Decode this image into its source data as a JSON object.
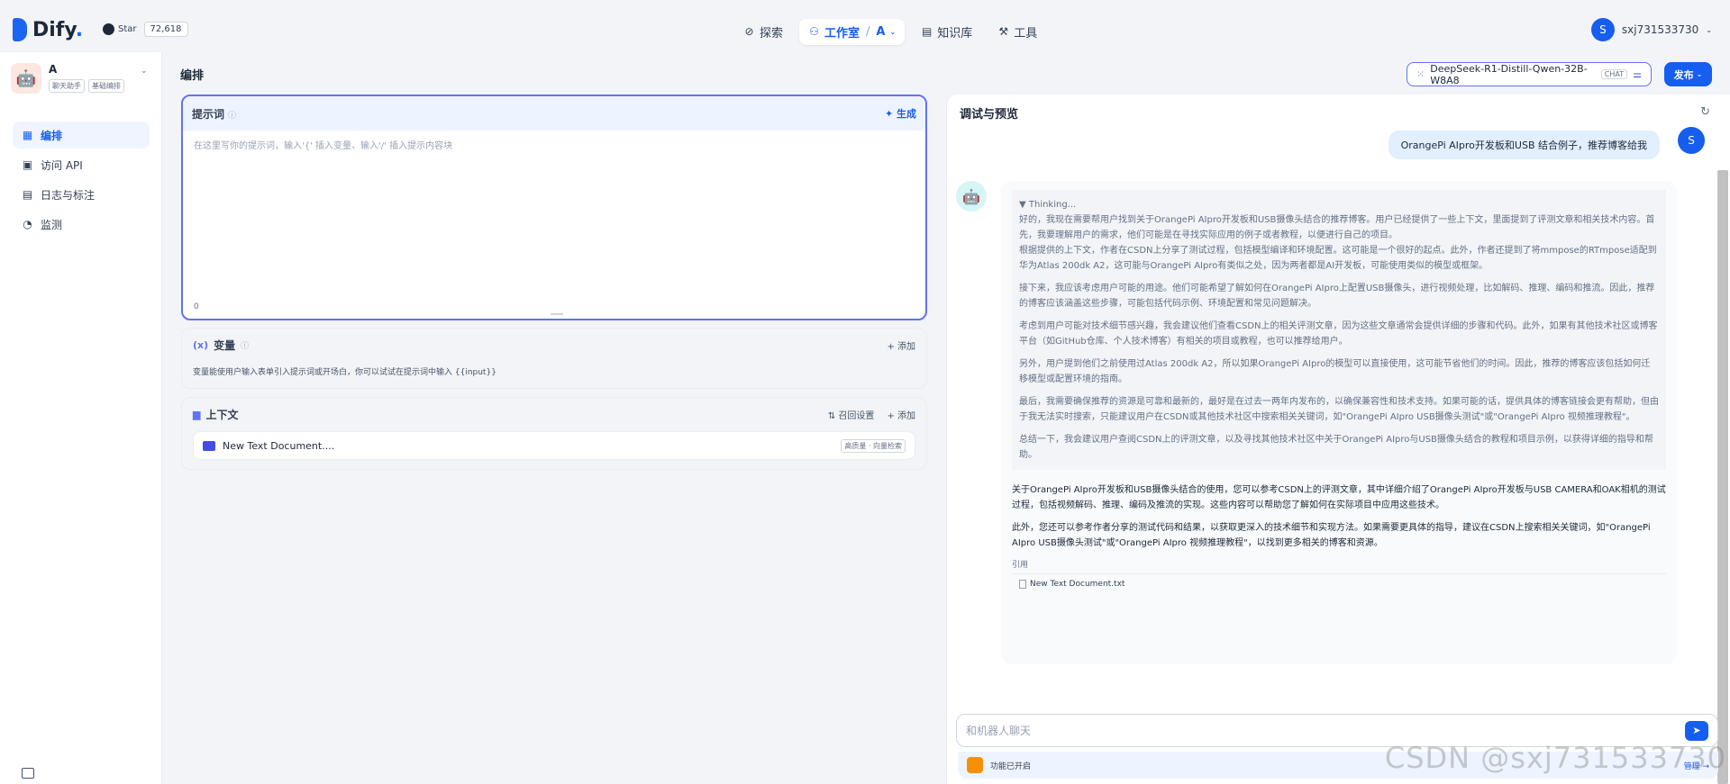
{
  "header": {
    "logo_text": "Dify",
    "github_label": "Star",
    "github_count": "72,618",
    "nav": [
      {
        "label": "探索",
        "icon": "compass-icon"
      },
      {
        "label": "工作室",
        "icon": "robot-icon",
        "suffix": "A"
      },
      {
        "label": "知识库",
        "icon": "book-icon"
      },
      {
        "label": "工具",
        "icon": "hammer-icon"
      }
    ],
    "user_initial": "S",
    "user_name": "sxj731533730"
  },
  "sidebar": {
    "app_name": "A",
    "app_tags": [
      "聊天助手",
      "基础编排"
    ],
    "items": [
      {
        "label": "编排",
        "icon": "layout-icon",
        "active": true
      },
      {
        "label": "访问 API",
        "icon": "terminal-icon"
      },
      {
        "label": "日志与标注",
        "icon": "file-list-icon"
      },
      {
        "label": "监测",
        "icon": "gauge-icon"
      }
    ]
  },
  "main": {
    "page_title": "编排",
    "prompt": {
      "title": "提示词",
      "generate_label": "生成",
      "placeholder": "在这里写你的提示词，输入'{' 插入变量、输入'/' 插入提示内容块",
      "char_count": "0"
    },
    "variables": {
      "title": "变量",
      "add_label": "添加",
      "description": "变量能使用户输入表单引入提示词或开场白，你可以试试在提示词中输入 {{input}}"
    },
    "context": {
      "title": "上下文",
      "recall_label": "召回设置",
      "add_label": "添加",
      "doc_name": "New Text Document....",
      "doc_tag": "高质量 · 向量检索"
    }
  },
  "model": {
    "name": "DeepSeek-R1-Distill-Qwen-32B-W8A8",
    "badge": "CHAT",
    "publish_label": "发布"
  },
  "preview": {
    "title": "调试与预览",
    "user_message": "OrangePi AIpro开发板和USB 结合例子，推荐博客给我",
    "user_initial": "S",
    "thinking_label": "▼ Thinking...",
    "thinking": [
      "好的，我现在需要帮用户找到关于OrangePi AIpro开发板和USB摄像头结合的推荐博客。用户已经提供了一些上下文，里面提到了评测文章和相关技术内容。首先，我要理解用户的需求，他们可能是在寻找实际应用的例子或者教程，以便进行自己的项目。\n根据提供的上下文，作者在CSDN上分享了测试过程，包括模型编译和环境配置。这可能是一个很好的起点。此外，作者还提到了将mmpose的RTmpose适配到华为Atlas 200dk A2，这可能与OrangePi AIpro有类似之处，因为两者都是AI开发板，可能使用类似的模型或框架。",
      "接下来，我应该考虑用户可能的用途。他们可能希望了解如何在OrangePi AIpro上配置USB摄像头，进行视频处理，比如解码、推理、编码和推流。因此，推荐的博客应该涵盖这些步骤，可能包括代码示例、环境配置和常见问题解决。",
      "考虑到用户可能对技术细节感兴趣，我会建议他们查看CSDN上的相关评测文章，因为这些文章通常会提供详细的步骤和代码。此外，如果有其他技术社区或博客平台（如GitHub仓库、个人技术博客）有相关的项目或教程，也可以推荐给用户。",
      "另外，用户提到他们之前使用过Atlas 200dk A2，所以如果OrangePi AIpro的模型可以直接使用，这可能节省他们的时间。因此，推荐的博客应该包括如何迁移模型或配置环境的指南。",
      "最后，我需要确保推荐的资源是可靠和最新的，最好是在过去一两年内发布的，以确保兼容性和技术支持。如果可能的话，提供具体的博客链接会更有帮助，但由于我无法实时搜索，只能建议用户在CSDN或其他技术社区中搜索相关关键词，如\"OrangePi AIpro USB摄像头测试\"或\"OrangePi AIpro 视频推理教程\"。",
      "总结一下，我会建议用户查阅CSDN上的评测文章，以及寻找其他技术社区中关于OrangePi AIpro与USB摄像头结合的教程和项目示例，以获得详细的指导和帮助。"
    ],
    "answer": [
      "关于OrangePi AIpro开发板和USB摄像头结合的使用，您可以参考CSDN上的评测文章，其中详细介绍了OrangePi AIpro开发板与USB CAMERA和OAK相机的测试过程，包括视频解码、推理、编码及推流的实现。这些内容可以帮助您了解如何在实际项目中应用这些技术。",
      "此外，您还可以参考作者分享的测试代码和结果，以获取更深入的技术细节和实现方法。如果需要更具体的指导，建议在CSDN上搜索相关关键词，如\"OrangePi AIpro USB摄像头测试\"或\"OrangePi AIpro 视频推理教程\"，以找到更多相关的博客和资源。"
    ],
    "citation_label": "引用",
    "citation_doc": "New Text Document.txt",
    "input_placeholder": "和机器人聊天",
    "feature_label": "功能已开启",
    "feature_manage": "管理"
  },
  "watermark": "CSDN @sxj731533730"
}
